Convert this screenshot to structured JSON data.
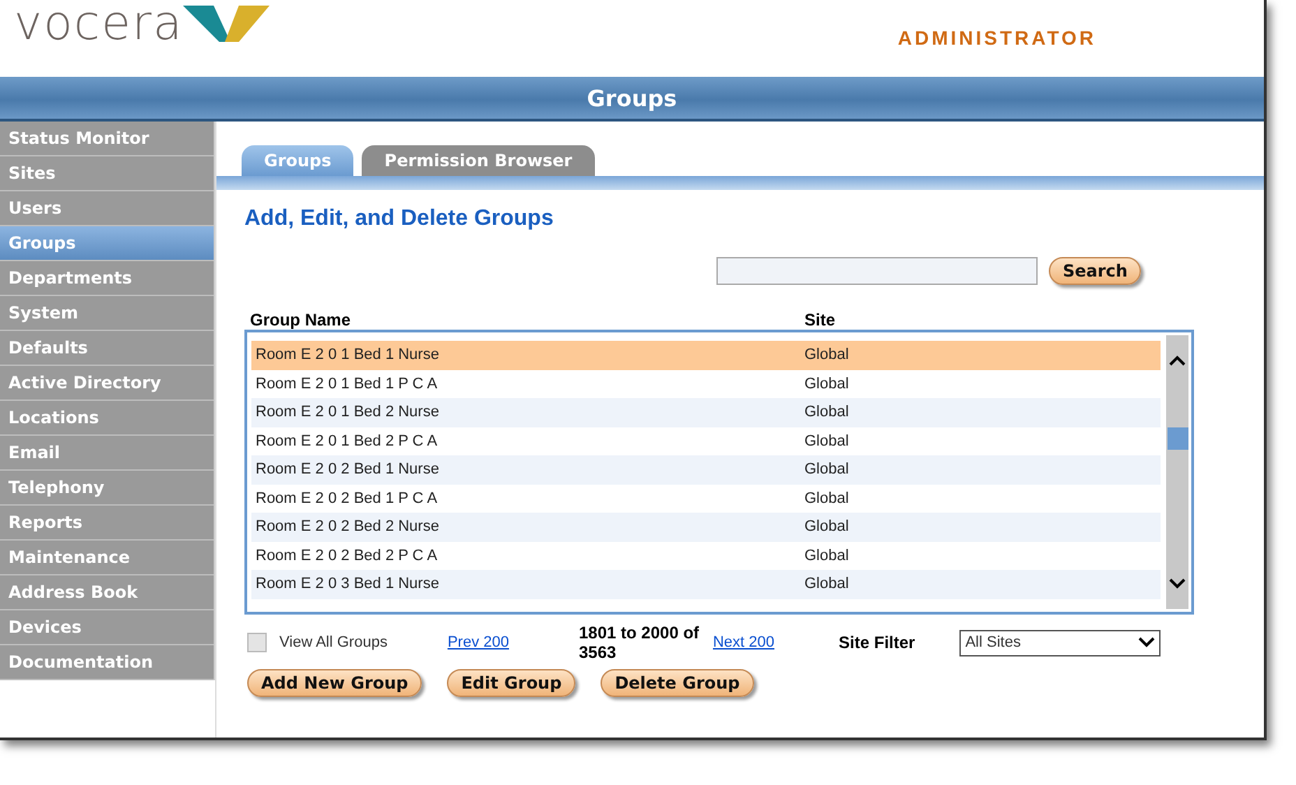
{
  "header": {
    "logo_text": "vocera",
    "role": "ADMINISTRATOR"
  },
  "banner": {
    "title": "Groups"
  },
  "sidebar": {
    "items": [
      {
        "label": "Status Monitor",
        "selected": false
      },
      {
        "label": "Sites",
        "selected": false
      },
      {
        "label": "Users",
        "selected": false
      },
      {
        "label": "Groups",
        "selected": true
      },
      {
        "label": "Departments",
        "selected": false
      },
      {
        "label": "System",
        "selected": false
      },
      {
        "label": "Defaults",
        "selected": false
      },
      {
        "label": "Active Directory",
        "selected": false
      },
      {
        "label": "Locations",
        "selected": false
      },
      {
        "label": "Email",
        "selected": false
      },
      {
        "label": "Telephony",
        "selected": false
      },
      {
        "label": "Reports",
        "selected": false
      },
      {
        "label": "Maintenance",
        "selected": false
      },
      {
        "label": "Address Book",
        "selected": false
      },
      {
        "label": "Devices",
        "selected": false
      },
      {
        "label": "Documentation",
        "selected": false
      }
    ]
  },
  "tabs": [
    {
      "label": "Groups",
      "selected": true
    },
    {
      "label": "Permission Browser",
      "selected": false
    }
  ],
  "heading": "Add, Edit, and Delete Groups",
  "search": {
    "button": "Search"
  },
  "table": {
    "columns": [
      "Group Name",
      "Site"
    ],
    "rows": [
      {
        "name": "Room E 2 0 1 Bed 1 Nurse",
        "site": "Global",
        "selected": true
      },
      {
        "name": "Room E 2 0 1 Bed 1 P C A",
        "site": "Global",
        "selected": false
      },
      {
        "name": "Room E 2 0 1 Bed 2 Nurse",
        "site": "Global",
        "selected": false
      },
      {
        "name": "Room E 2 0 1 Bed 2 P C A",
        "site": "Global",
        "selected": false
      },
      {
        "name": "Room E 2 0 2 Bed 1 Nurse",
        "site": "Global",
        "selected": false
      },
      {
        "name": "Room E 2 0 2 Bed 1 P C A",
        "site": "Global",
        "selected": false
      },
      {
        "name": "Room E 2 0 2 Bed 2 Nurse",
        "site": "Global",
        "selected": false
      },
      {
        "name": "Room E 2 0 2 Bed 2 P C A",
        "site": "Global",
        "selected": false
      },
      {
        "name": "Room E 2 0 3 Bed 1 Nurse",
        "site": "Global",
        "selected": false
      }
    ]
  },
  "pager": {
    "view_all": {
      "label": "View All Groups",
      "checked": false
    },
    "prev": "Prev 200",
    "range": "1801 to 2000 of 3563",
    "next": "Next 200",
    "filter_label": "Site Filter",
    "filter_value": "All Sites"
  },
  "buttons": [
    "Add New Group",
    "Edit Group",
    "Delete Group"
  ]
}
